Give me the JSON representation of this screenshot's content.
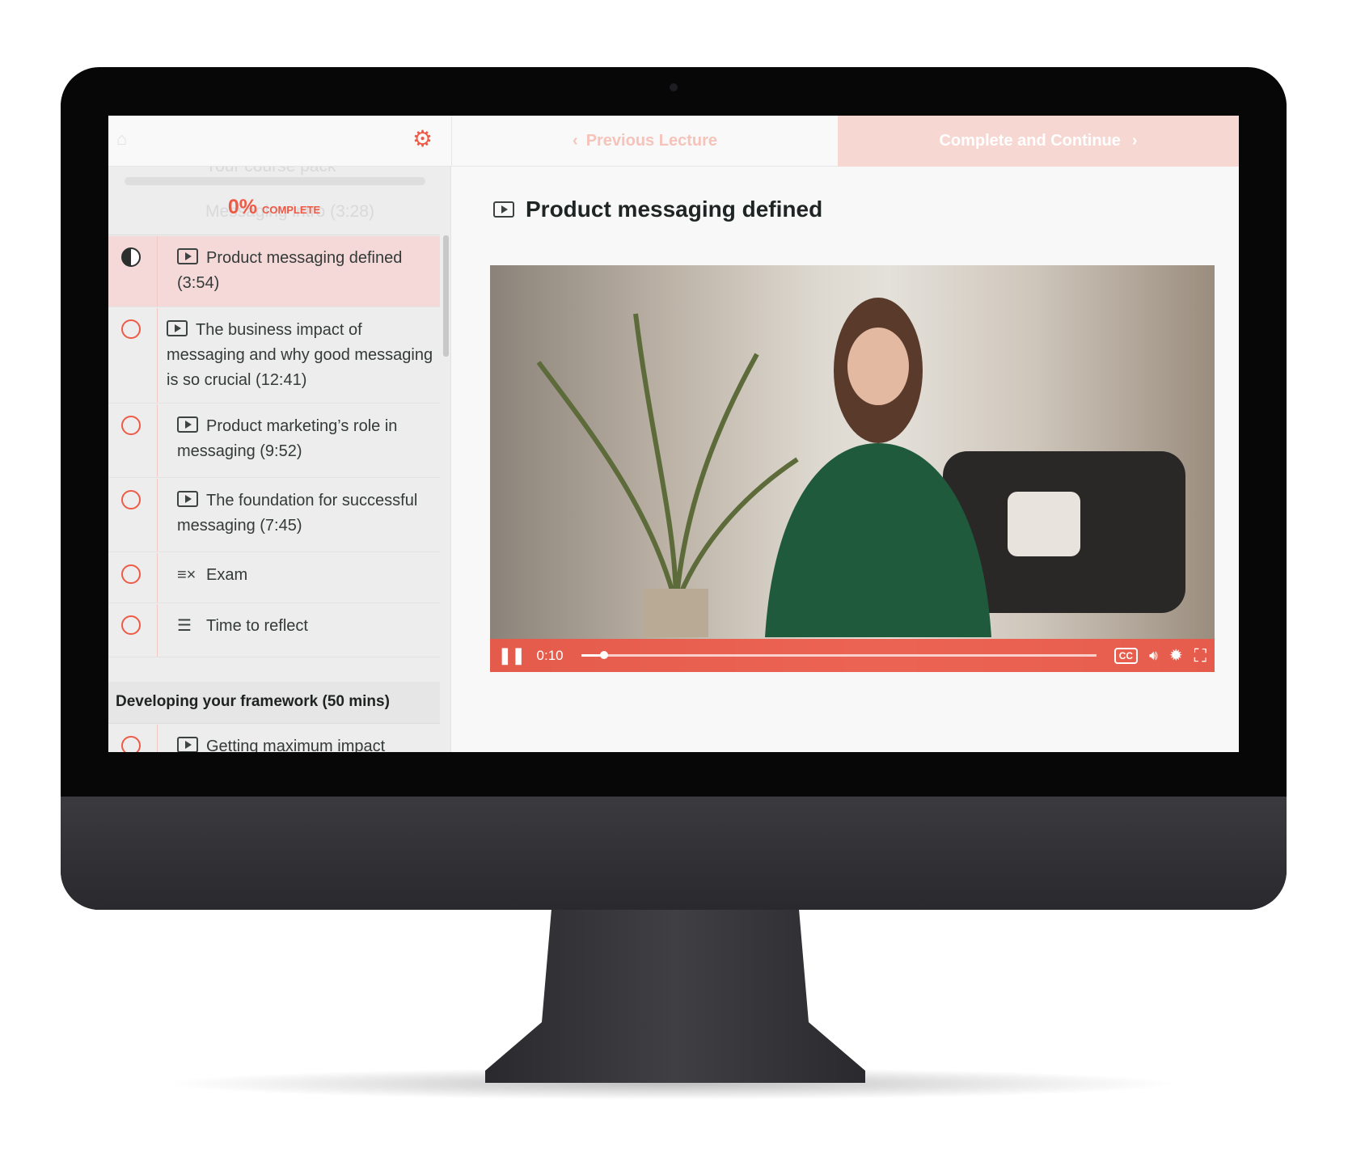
{
  "header": {
    "previous_label": "Previous Lecture",
    "complete_label": "Complete and Continue",
    "home_icon": "home-icon",
    "settings_icon": "gear-icon"
  },
  "sidebar": {
    "progress": {
      "percent_label": "0%",
      "complete_label": "COMPLETE",
      "value": 0
    },
    "faded_items": [
      "Your course pack",
      "Messaging intro (3:28)"
    ],
    "items": [
      {
        "label": "Product messaging defined (3:54)",
        "type": "video",
        "status": "in-progress",
        "active": true
      },
      {
        "label": "The business impact of messaging and why good messaging is so crucial (12:41)",
        "type": "video",
        "status": "incomplete"
      },
      {
        "label": "Product marketing’s role in messaging (9:52)",
        "type": "video",
        "status": "incomplete"
      },
      {
        "label": "The foundation for successful messaging (7:45)",
        "type": "video",
        "status": "incomplete"
      },
      {
        "label": "Exam",
        "type": "quiz",
        "status": "incomplete"
      },
      {
        "label": "Time to reflect",
        "type": "text",
        "status": "incomplete"
      }
    ],
    "section_title": "Developing your framework (50 mins)",
    "next_item": "Getting maximum impact"
  },
  "main": {
    "title": "Product messaging defined"
  },
  "video": {
    "time": "0:10",
    "progress_fraction": 0.045,
    "cc_label": "CC",
    "accent": "#ef5a46"
  }
}
